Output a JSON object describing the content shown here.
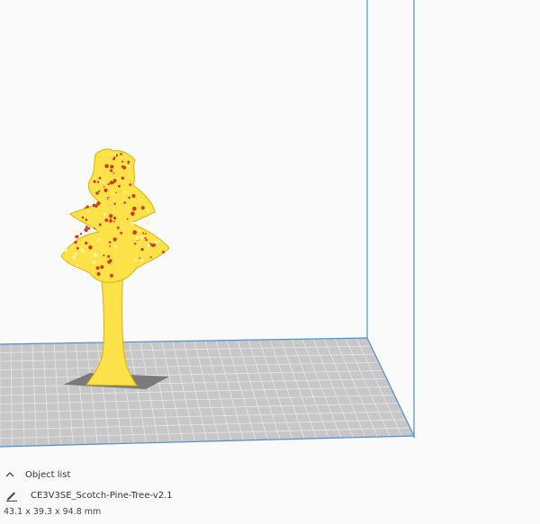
{
  "object_panel": {
    "title": "Object list",
    "object_name": "CE3V3SE_Scotch-Pine-Tree-v2.1",
    "dimensions": "43.1 x 39.3 x 94.8 mm"
  },
  "colors": {
    "background": "#fafafa",
    "build_plate": "#c4c4c4",
    "grid_lines": "#e6e6e6",
    "volume_outline": "#4a8fd0",
    "model_fill": "#ffe14a",
    "model_overhang": "#d23a1e",
    "model_shadow": "#777777"
  },
  "icons": {
    "collapse": "chevron-up-icon",
    "edit": "pencil-icon"
  }
}
